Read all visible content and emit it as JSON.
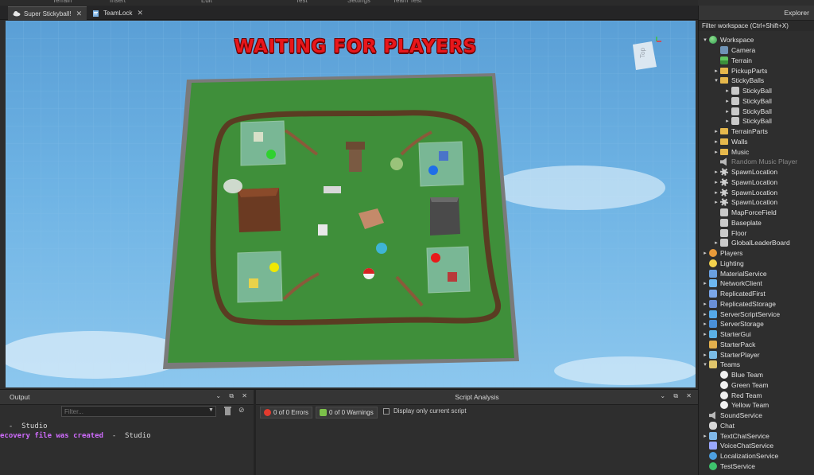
{
  "ribbon": {
    "items": [
      "Terrain",
      "Insert",
      "Edit",
      "Test",
      "Settings",
      "Team Test"
    ]
  },
  "tabs": [
    {
      "label": "Super Stickyball!",
      "active": true,
      "icon": "cloud-icon"
    },
    {
      "label": "TeamLock",
      "active": false,
      "icon": "script-icon"
    }
  ],
  "viewport": {
    "status_text": "WAITING FOR PLAYERS",
    "viewcube_label": "Top"
  },
  "output": {
    "title": "Output",
    "filter_placeholder": "Filter...",
    "lines": [
      {
        "message": "",
        "source": "  -  Studio"
      },
      {
        "message": "ecovery file was created",
        "source": "  -  Studio"
      }
    ]
  },
  "script_analysis": {
    "title": "Script Analysis",
    "errors_label": "0 of 0 Errors",
    "warnings_label": "0 of 0 Warnings",
    "only_current_label": "Display only current script"
  },
  "explorer": {
    "title": "Explorer",
    "filter_label": "Filter workspace (Ctrl+Shift+X)",
    "items": [
      {
        "label": "Workspace",
        "depth": 0,
        "arrow": "▾",
        "icon": "workspace-icon",
        "cls": "ic-globe"
      },
      {
        "label": "Camera",
        "depth": 1,
        "arrow": "",
        "icon": "camera-icon",
        "cls": "ic-camera"
      },
      {
        "label": "Terrain",
        "depth": 1,
        "arrow": "",
        "icon": "terrain-icon",
        "cls": "ic-terrain"
      },
      {
        "label": "PickupParts",
        "depth": 1,
        "arrow": "▸",
        "icon": "folder-icon",
        "cls": "ic-folder"
      },
      {
        "label": "StickyBalls",
        "depth": 1,
        "arrow": "▾",
        "icon": "folder-icon",
        "cls": "ic-folder"
      },
      {
        "label": "StickyBall",
        "depth": 2,
        "arrow": "▸",
        "icon": "part-icon",
        "cls": "ic-part"
      },
      {
        "label": "StickyBall",
        "depth": 2,
        "arrow": "▸",
        "icon": "part-icon",
        "cls": "ic-part"
      },
      {
        "label": "StickyBall",
        "depth": 2,
        "arrow": "▸",
        "icon": "part-icon",
        "cls": "ic-part"
      },
      {
        "label": "StickyBall",
        "depth": 2,
        "arrow": "▸",
        "icon": "part-icon",
        "cls": "ic-part"
      },
      {
        "label": "TerrainParts",
        "depth": 1,
        "arrow": "▸",
        "icon": "folder-icon",
        "cls": "ic-folder"
      },
      {
        "label": "Walls",
        "depth": 1,
        "arrow": "▸",
        "icon": "folder-icon",
        "cls": "ic-folder"
      },
      {
        "label": "Music",
        "depth": 1,
        "arrow": "▸",
        "icon": "folder-icon",
        "cls": "ic-folder"
      },
      {
        "label": "Random Music Player",
        "depth": 1,
        "arrow": "",
        "icon": "sound-icon",
        "cls": "ic-sound",
        "dim": true
      },
      {
        "label": "SpawnLocation",
        "depth": 1,
        "arrow": "▸",
        "icon": "spawn-icon",
        "cls": "ic-spawn"
      },
      {
        "label": "SpawnLocation",
        "depth": 1,
        "arrow": "▸",
        "icon": "spawn-icon",
        "cls": "ic-spawn"
      },
      {
        "label": "SpawnLocation",
        "depth": 1,
        "arrow": "▸",
        "icon": "spawn-icon",
        "cls": "ic-spawn"
      },
      {
        "label": "SpawnLocation",
        "depth": 1,
        "arrow": "▸",
        "icon": "spawn-icon",
        "cls": "ic-spawn"
      },
      {
        "label": "MapForceField",
        "depth": 1,
        "arrow": "",
        "icon": "part-icon",
        "cls": "ic-part"
      },
      {
        "label": "Baseplate",
        "depth": 1,
        "arrow": "",
        "icon": "part-icon",
        "cls": "ic-part"
      },
      {
        "label": "Floor",
        "depth": 1,
        "arrow": "",
        "icon": "part-icon",
        "cls": "ic-part"
      },
      {
        "label": "GlobalLeaderBoard",
        "depth": 1,
        "arrow": "▸",
        "icon": "part-icon",
        "cls": "ic-part"
      },
      {
        "label": "Players",
        "depth": 0,
        "arrow": "▸",
        "icon": "players-icon",
        "cls": "ic-players"
      },
      {
        "label": "Lighting",
        "depth": 0,
        "arrow": "",
        "icon": "lighting-icon",
        "cls": "ic-lighting"
      },
      {
        "label": "MaterialService",
        "depth": 0,
        "arrow": "",
        "icon": "material-service-icon",
        "cls": "ic-material"
      },
      {
        "label": "NetworkClient",
        "depth": 0,
        "arrow": "▸",
        "icon": "network-client-icon",
        "cls": "ic-network"
      },
      {
        "label": "ReplicatedFirst",
        "depth": 0,
        "arrow": "",
        "icon": "replicated-first-icon",
        "cls": "ic-repfirst"
      },
      {
        "label": "ReplicatedStorage",
        "depth": 0,
        "arrow": "▸",
        "icon": "replicated-storage-icon",
        "cls": "ic-repstore"
      },
      {
        "label": "ServerScriptService",
        "depth": 0,
        "arrow": "▸",
        "icon": "server-script-service-icon",
        "cls": "ic-sss"
      },
      {
        "label": "ServerStorage",
        "depth": 0,
        "arrow": "▸",
        "icon": "server-storage-icon",
        "cls": "ic-ss"
      },
      {
        "label": "StarterGui",
        "depth": 0,
        "arrow": "▸",
        "icon": "starter-gui-icon",
        "cls": "ic-gui"
      },
      {
        "label": "StarterPack",
        "depth": 0,
        "arrow": "",
        "icon": "starter-pack-icon",
        "cls": "ic-pack"
      },
      {
        "label": "StarterPlayer",
        "depth": 0,
        "arrow": "▸",
        "icon": "starter-player-icon",
        "cls": "ic-player"
      },
      {
        "label": "Teams",
        "depth": 0,
        "arrow": "▾",
        "icon": "teams-icon",
        "cls": "ic-teams"
      },
      {
        "label": "Blue Team",
        "depth": 1,
        "arrow": "",
        "icon": "team-icon",
        "cls": "ic-team"
      },
      {
        "label": "Green Team",
        "depth": 1,
        "arrow": "",
        "icon": "team-icon",
        "cls": "ic-team"
      },
      {
        "label": "Red Team",
        "depth": 1,
        "arrow": "",
        "icon": "team-icon",
        "cls": "ic-team"
      },
      {
        "label": "Yellow Team",
        "depth": 1,
        "arrow": "",
        "icon": "team-icon",
        "cls": "ic-team"
      },
      {
        "label": "SoundService",
        "depth": 0,
        "arrow": "",
        "icon": "sound-service-icon",
        "cls": "ic-sound"
      },
      {
        "label": "Chat",
        "depth": 0,
        "arrow": "",
        "icon": "chat-icon",
        "cls": "ic-chat"
      },
      {
        "label": "TextChatService",
        "depth": 0,
        "arrow": "▸",
        "icon": "text-chat-service-icon",
        "cls": "ic-tcs"
      },
      {
        "label": "VoiceChatService",
        "depth": 0,
        "arrow": "",
        "icon": "voice-chat-service-icon",
        "cls": "ic-vcs"
      },
      {
        "label": "LocalizationService",
        "depth": 0,
        "arrow": "",
        "icon": "localization-service-icon",
        "cls": "ic-loc"
      },
      {
        "label": "TestService",
        "depth": 0,
        "arrow": "",
        "icon": "test-service-icon",
        "cls": "ic-test"
      }
    ]
  },
  "colors": {
    "green_team": "#2fd12f",
    "blue_team": "#1f6fe8",
    "red_team": "#e81a1a",
    "yellow_team": "#f0e800",
    "status_red": "#e8171b"
  }
}
